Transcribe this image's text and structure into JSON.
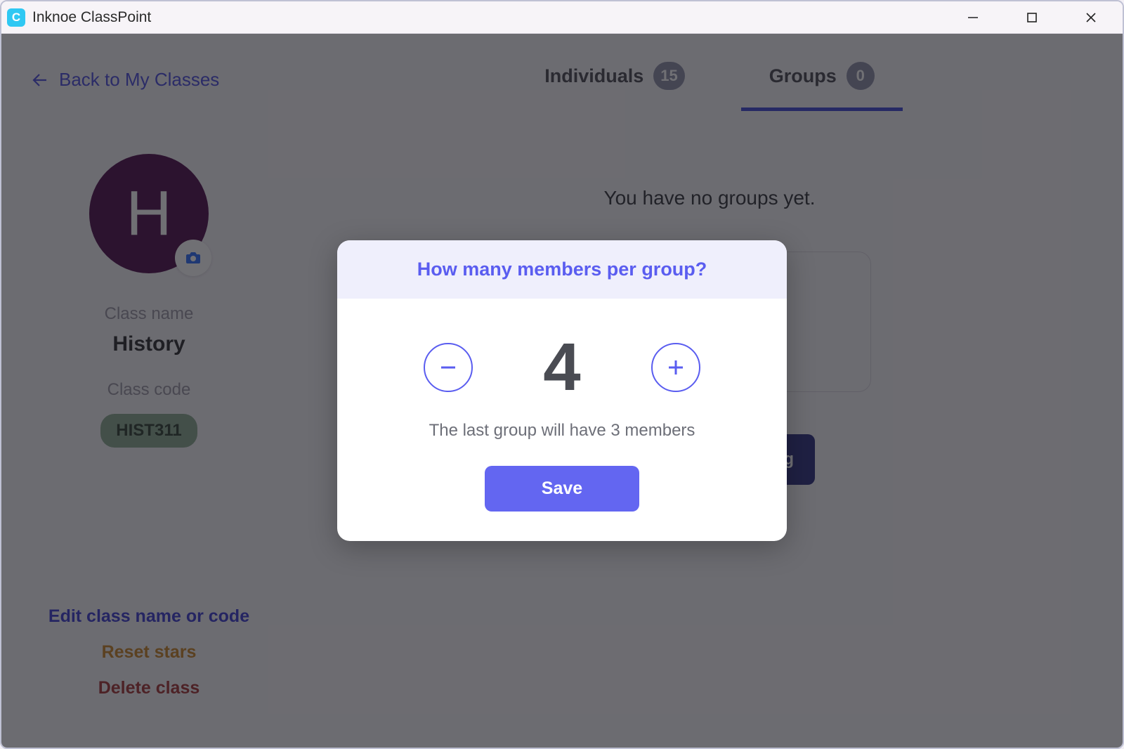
{
  "titlebar": {
    "app_title": "Inknoe ClassPoint",
    "icon_letter": "C"
  },
  "sidebar": {
    "back_label": "Back to My Classes",
    "avatar_letter": "H",
    "class_name_label": "Class name",
    "class_name": "History",
    "class_code_label": "Class code",
    "class_code": "HIST311",
    "actions": {
      "edit": "Edit class name or code",
      "reset": "Reset stars",
      "delete": "Delete class"
    }
  },
  "main": {
    "tabs": {
      "individuals": {
        "label": "Individuals",
        "count": "15"
      },
      "groups": {
        "label": "Groups",
        "count": "0"
      }
    },
    "empty_message": "You have no groups yet.",
    "auto_button": "ng"
  },
  "dialog": {
    "title": "How many members per group?",
    "value": "4",
    "hint": "The last group will have 3 members",
    "save": "Save"
  }
}
